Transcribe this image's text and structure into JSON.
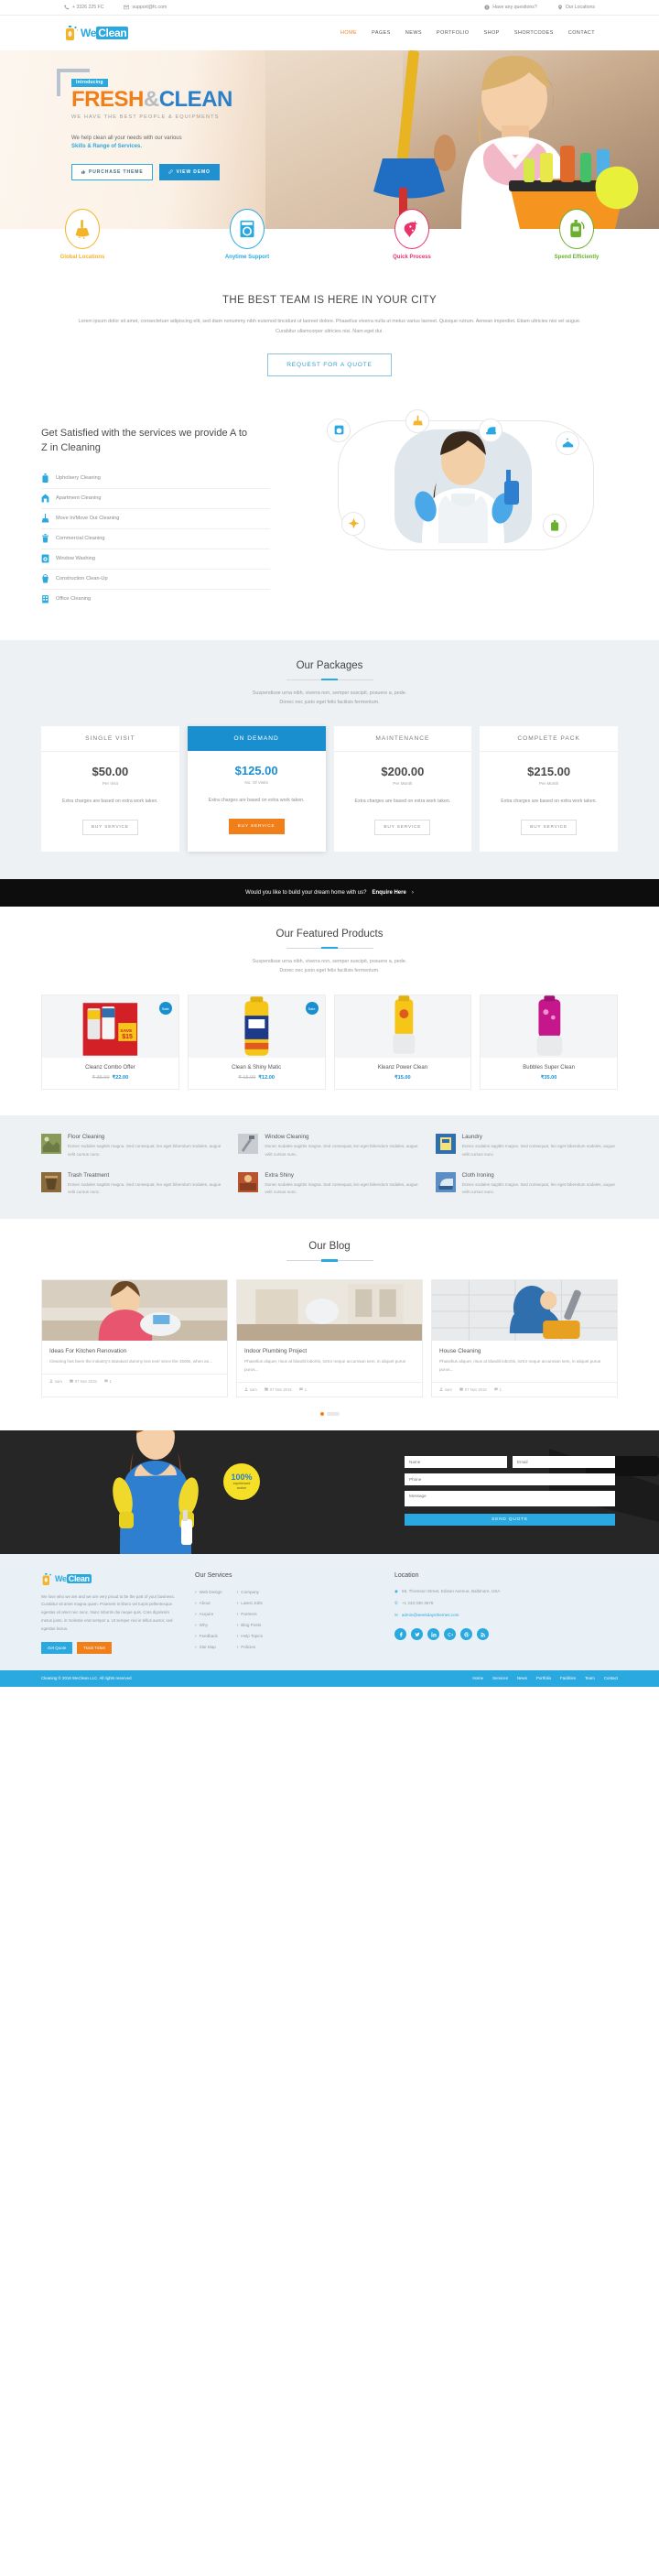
{
  "topbar": {
    "phone": "+ 3326 225 FC",
    "email": "support@fc.com",
    "questions": "Have any questions?",
    "locations": "Our Locations"
  },
  "header": {
    "logo_we": "We",
    "logo_clean": "Clean",
    "nav": [
      {
        "label": "HOME",
        "active": true
      },
      {
        "label": "PAGES",
        "active": false
      },
      {
        "label": "NEWS",
        "active": false
      },
      {
        "label": "PORTFOLIO",
        "active": false
      },
      {
        "label": "SHOP",
        "active": false
      },
      {
        "label": "SHORTCODES",
        "active": false
      },
      {
        "label": "CONTACT",
        "active": false
      }
    ]
  },
  "hero": {
    "badge": "Introducing",
    "title_1": "FRESH",
    "title_amp": "&",
    "title_2": "CLEAN",
    "subtitle": "WE HAVE THE BEST PEOPLE & EQUIPMENTS",
    "paragraph": "We help clean all your needs with our various",
    "paragraph_link": "Skills & Range of Services.",
    "btn_primary": "PURCHASE THEME",
    "btn_secondary": "VIEW DEMO"
  },
  "features": [
    {
      "label": "Global Locations",
      "color": "#f3b32b",
      "icon": "broom-icon"
    },
    {
      "label": "Anytime Support",
      "color": "#2aa9e0",
      "icon": "washer-icon"
    },
    {
      "label": "Quick Process",
      "color": "#e8336b",
      "icon": "sponge-icon"
    },
    {
      "label": "Spend Efficiently",
      "color": "#6ab02e",
      "icon": "spray-bottle-icon"
    }
  ],
  "team": {
    "title": "THE BEST TEAM IS HERE IN YOUR CITY",
    "paragraph": "Lorem ipsum dolor sit amet, consectetuer adipiscing elit, sed diam nonummy nibh euismod tincidunt ut laoreet dolore. Phasellus viverra nulla ut metus varius laoreet. Quisque rutrum. Aenean imperdiet. Etiam ultricies nisi vel augue. Curabitur ullamcorper ultricies nisi. Nam eget dui.",
    "button": "REQUEST FOR A QUOTE"
  },
  "services": {
    "heading": "Get Satisfied with the services we provide A to Z in Cleaning",
    "items": [
      {
        "label": "Upholsery Cleaning",
        "icon": "bottle-icon"
      },
      {
        "label": "Apartment Cleaning",
        "icon": "apartment-icon"
      },
      {
        "label": "Move In/Move Out Cleaning",
        "icon": "broom-icon"
      },
      {
        "label": "Commercial Cleaning",
        "icon": "trash-icon"
      },
      {
        "label": "Window Washing",
        "icon": "window-icon"
      },
      {
        "label": "Construction Clean-Up",
        "icon": "bucket-icon"
      },
      {
        "label": "Office Cleaning",
        "icon": "office-icon"
      }
    ]
  },
  "packages": {
    "title": "Our Packages",
    "sub_line1": "Suspendisse urna nibh, viverra non, semper suscipit, posuere a, pede.",
    "sub_line2": "Donec nec justo eget felis facilisis fermentum.",
    "plans": [
      {
        "name": "SINGLE VISIT",
        "price": "$50.00",
        "unit": "Per Visit",
        "desc": "Extra charges are based on extra work taken.",
        "button": "BUY SERVICE",
        "featured": false
      },
      {
        "name": "ON DEMAND",
        "price": "$125.00",
        "unit": "No. Of Visits",
        "desc": "Extra charges are based on extra work taken.",
        "button": "BUY SERVICE",
        "featured": true
      },
      {
        "name": "MAINTENANCE",
        "price": "$200.00",
        "unit": "Per Month",
        "desc": "Extra charges are based on extra work taken.",
        "button": "BUY SERVICE",
        "featured": false
      },
      {
        "name": "COMPLETE PACK",
        "price": "$215.00",
        "unit": "Per Month",
        "desc": "Extra charges are based on extra work taken.",
        "button": "BUY SERVICE",
        "featured": false
      }
    ]
  },
  "cta": {
    "text": "Would you like to build your dream home with us?",
    "link": "Enquire Here"
  },
  "products": {
    "title": "Our Featured Products",
    "sub_line1": "Suspendisse urna nibh, viverra non, semper suscipit, posuere a, pede.",
    "sub_line2": "Donec nec justo eget felis facilisis fermentum.",
    "items": [
      {
        "name": "Cleanz Combo Offer",
        "old_price": "₹ 35.00",
        "price": "₹22.00",
        "sale": "Sale",
        "on_sale": true,
        "color": "#d32027"
      },
      {
        "name": "Clean & Shiny Matic",
        "old_price": "₹ 15.00",
        "price": "₹12.00",
        "sale": "Sale",
        "on_sale": true,
        "color": "#f5c518"
      },
      {
        "name": "Kleanz Power Clean",
        "old_price": "",
        "price": "₹15.00",
        "sale": "",
        "on_sale": false,
        "color": "#f5c518"
      },
      {
        "name": "Bubbles Super Clean",
        "old_price": "",
        "price": "₹35.00",
        "sale": "",
        "on_sale": false,
        "color": "#c5168c"
      }
    ]
  },
  "service_grid": [
    {
      "title": "Floor Cleaning",
      "desc": "Donec sodales sagittis magna. Sed consequat, leo eget bibendum sodales, augue velit cursus nunc.",
      "color": "#8a9a5b"
    },
    {
      "title": "Window Cleaning",
      "desc": "Donec sodales sagittis magna. Sed consequat, leo eget bibendum sodales, augue velit cursus nunc.",
      "color": "#c9ccd1"
    },
    {
      "title": "Laundry",
      "desc": "Donec sodales sagittis magna. Sed consequat, leo eget bibendum sodales, augue velit cursus nunc.",
      "color": "#2f6fae"
    },
    {
      "title": "Trash Treatment",
      "desc": "Donec sodales sagittis magna. Sed consequat, leo eget bibendum sodales, augue velit cursus nunc.",
      "color": "#8a6a3b"
    },
    {
      "title": "Extra Shiny",
      "desc": "Donec sodales sagittis magna. Sed consequat, leo eget bibendum sodales, augue velit cursus nunc.",
      "color": "#b5542e"
    },
    {
      "title": "Cloth Ironing",
      "desc": "Donec sodales sagittis magna. Sed consequat, leo eget bibendum sodales, augue velit cursus nunc.",
      "color": "#5b8ec4"
    }
  ],
  "blog": {
    "title": "Our Blog",
    "posts": [
      {
        "title": "Ideas For Kitchen Renovation",
        "excerpt": "Cleaning has been the industry's standard dummy text ever since the 1500s, when an...",
        "author": "sam",
        "date": "07 Nov 2015",
        "comments": "1"
      },
      {
        "title": "Indoor Plumbing Project",
        "excerpt": "Phasellus aliquet, risus at blandit lobortis, tortor neque accumsan sem, in aliquet purus purus...",
        "author": "sam",
        "date": "07 Nov 2015",
        "comments": "1"
      },
      {
        "title": "House Cleaning",
        "excerpt": "Phasellus aliquet, risus at blandit lobortis, tortor neque accumsan sem, in aliquet purus purus...",
        "author": "sam",
        "date": "07 Nov 2015",
        "comments": "1"
      }
    ]
  },
  "quote_band": {
    "badge_number": "100%",
    "badge_line1": "experienced",
    "badge_line2": "worker",
    "name_placeholder": "Name",
    "email_placeholder": "Email",
    "phone_placeholder": "Phone",
    "message_placeholder": "Message",
    "submit": "SEND QUOTE"
  },
  "footer": {
    "logo_we": "We",
    "logo_clean": "Clean",
    "about": "We love who we are and we are very proud to be the part of your business. Curabitur sit amet magna quam. Praesent in libero vel turpis pellentesque egestas sit amet nec nunc. Nunc lobortis dui neque quis. Cras dignissim metus justo, in molestie erat semper a. Ut semper nisi in tellus auctor, sed egestas lectus.",
    "btn1": "Get Quote",
    "btn2": "Track Ticket",
    "services_heading": "Our Services",
    "services_col1": [
      "Web Design",
      "About",
      "Acquire",
      "Why",
      "Feedback",
      "Site Map"
    ],
    "services_col2": [
      "Company",
      "Latest Jobs",
      "Partners",
      "Blog Posts",
      "Help Topics",
      "Policies"
    ],
    "location_heading": "Location",
    "address": "56, Thomson Street, Edison Avenue, Baltimore, USA",
    "phone": "+1 233 030 3678",
    "email": "admin@weekdaysthemes.com"
  },
  "copyright": {
    "text": "Cleaning © 2016 WeClean LLC. All rights reserved",
    "links": [
      "Home",
      "Services",
      "News",
      "Portfolio",
      "Facilities",
      "Team",
      "Contact"
    ]
  }
}
